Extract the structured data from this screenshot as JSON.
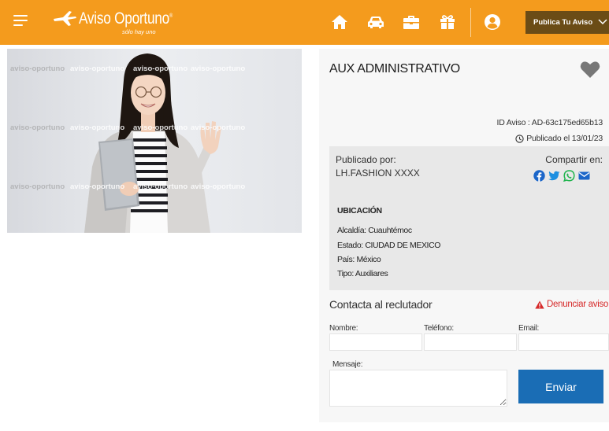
{
  "header": {
    "logo_text": "Aviso Oportuno",
    "logo_trademark": "®",
    "tagline": "sólo hay uno",
    "nav_icons": [
      "home-icon",
      "car-icon",
      "briefcase-icon",
      "gift-icon",
      "user-icon"
    ],
    "publica_label": "Publica Tu Aviso",
    "colors": {
      "bar": "#f49b1d",
      "publica_bg": "#6b4c16"
    }
  },
  "photo": {
    "watermark": "aviso-oportuno"
  },
  "job": {
    "title": "AUX ADMINISTRATIVO",
    "id_text": "ID Aviso : AD-63c175ed65b13",
    "published_text": "Publicado el 13/01/23",
    "publisher_label": "Publicado por:",
    "publisher_name": "LH.FASHION XXXX",
    "share_label": "Compartir en:",
    "share_icons": [
      "facebook-icon",
      "twitter-icon",
      "whatsapp-icon",
      "email-icon"
    ]
  },
  "location": {
    "title": "UBICACIÓN",
    "alcaldia": "Alcaldía: Cuauhtémoc",
    "estado": "Estado: CIUDAD DE MEXICO",
    "pais": "País: México",
    "tipo": "Tipo: Auxiliares"
  },
  "contact": {
    "title": "Contacta al reclutador",
    "report_label": "Denunciar aviso",
    "name_label": "Nombre:",
    "phone_label": "Teléfono:",
    "email_label": "Email:",
    "message_label": "Mensaje:",
    "name_value": "",
    "phone_value": "",
    "email_value": "",
    "message_value": "",
    "submit_label": "Enviar",
    "colors": {
      "submit": "#1a6db5",
      "report": "#d62a2a"
    }
  }
}
